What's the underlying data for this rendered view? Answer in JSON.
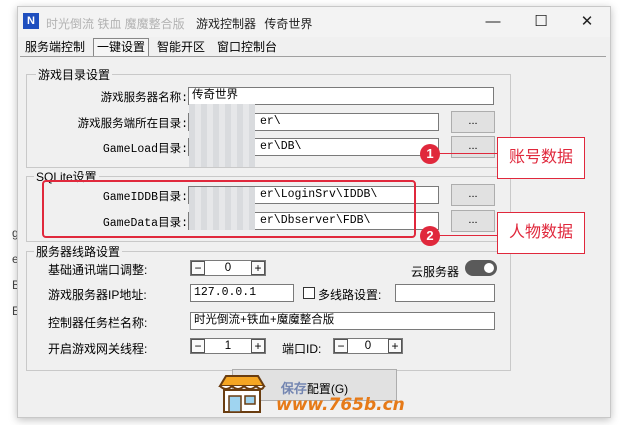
{
  "window": {
    "title_partial": "时光倒流 铁血 魔魔整合版",
    "title_suffix_1": "游戏控制器",
    "title_suffix_2": "传奇世界",
    "minimize": "—",
    "maximize": "☐",
    "close": "✕"
  },
  "tabs": [
    {
      "label": "服务端控制"
    },
    {
      "label": "一键设置"
    },
    {
      "label": "智能开区"
    },
    {
      "label": "窗口控制台"
    }
  ],
  "game_dir": {
    "title": "游戏目录设置",
    "server_name_label": "游戏服务器名称:",
    "server_name_value": "传奇世界",
    "server_dir_label": "游戏服务端所在目录:",
    "server_dir_value": "er\\",
    "gameload_label": "GameLoad目录:",
    "gameload_value": "er\\DB\\"
  },
  "sqlite": {
    "title": "SQLite设置",
    "iddb_label": "GameIDDB目录:",
    "iddb_value": "er\\LoginSrv\\IDDB\\",
    "data_label": "GameData目录:",
    "data_value": "er\\Dbserver\\FDB\\"
  },
  "browse_label": "...",
  "server_line": {
    "title": "服务器线路设置",
    "base_port_label": "基础通讯端口调整:",
    "base_port_value": "0",
    "cloud_label": "云服务器",
    "ip_label": "游戏服务器IP地址:",
    "ip_value": "127.0.0.1",
    "multi_line_label": "多线路设置:",
    "multi_line_value": "",
    "taskbar_label": "控制器任务栏名称:",
    "taskbar_value": "时光倒流+铁血+魔魔整合版",
    "gateway_label": "开启游戏网关线程:",
    "gateway_value": "1",
    "port_id_label": "端口ID:",
    "port_id_value": "0",
    "minus": "−",
    "plus": "+"
  },
  "save_button": {
    "label": "配置(G)",
    "prefix_blur": "保存"
  },
  "annotations": {
    "n1": "1",
    "n2": "2",
    "account_label": "账号数据",
    "character_label": "人物数据"
  },
  "watermark": {
    "text": "www.765b.cn"
  },
  "left_edge": [
    "g",
    "e",
    "B",
    "E"
  ],
  "colors": {
    "annotation_red": "#e0283c",
    "watermark_orange": "#e67a18",
    "window_bg": "#f0f0f0"
  }
}
